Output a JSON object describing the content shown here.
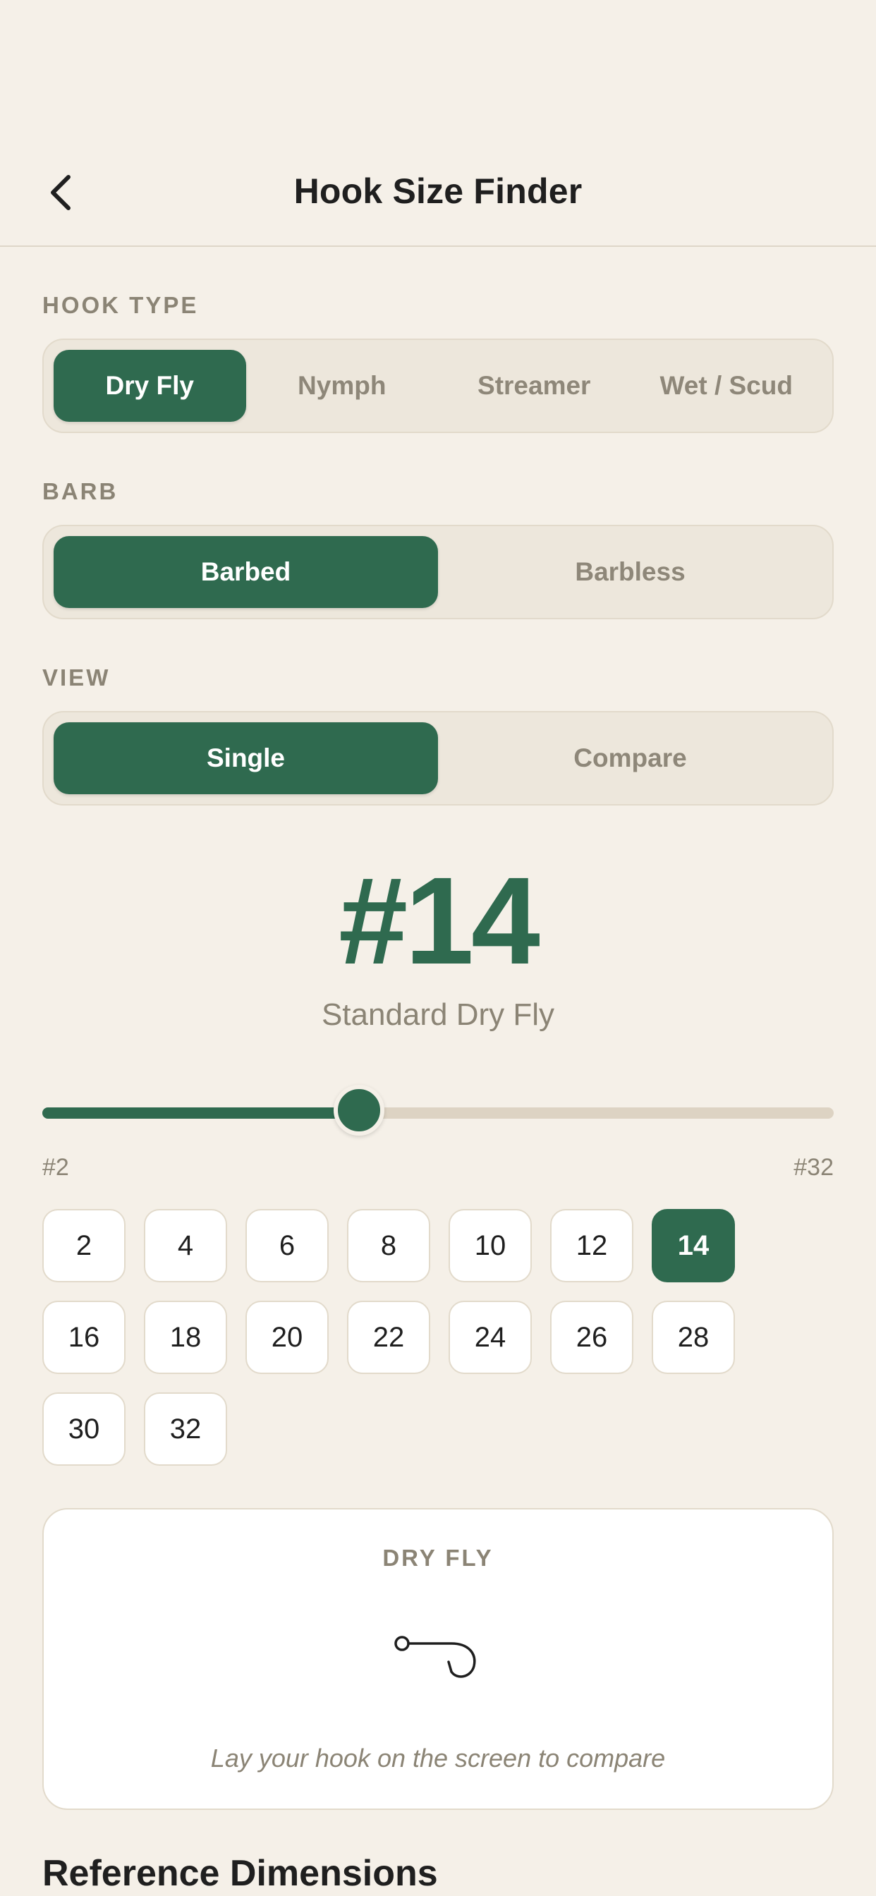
{
  "nav": {
    "title": "Hook Size Finder",
    "back_icon": "chevron-left-icon"
  },
  "hook_type": {
    "label": "HOOK TYPE",
    "options": [
      "Dry Fly",
      "Nymph",
      "Streamer",
      "Wet / Scud"
    ],
    "selected": "Dry Fly"
  },
  "barb": {
    "label": "BARB",
    "options": [
      "Barbed",
      "Barbless"
    ],
    "selected": "Barbed"
  },
  "view": {
    "label": "VIEW",
    "options": [
      "Single",
      "Compare"
    ],
    "selected": "Single"
  },
  "selected_size": {
    "display": "#14",
    "description": "Standard Dry Fly"
  },
  "slider": {
    "min_label": "#2",
    "max_label": "#32",
    "min": 2,
    "max": 32,
    "value": 14
  },
  "sizes": [
    "2",
    "4",
    "6",
    "8",
    "10",
    "12",
    "14",
    "16",
    "18",
    "20",
    "22",
    "24",
    "26",
    "28",
    "30",
    "32"
  ],
  "active_size": "14",
  "preview": {
    "label": "DRY FLY",
    "icon": "hook-icon",
    "hint": "Lay your hook on the screen to compare"
  },
  "reference": {
    "heading": "Reference Dimensions"
  },
  "colors": {
    "accent": "#2f6a4f",
    "background": "#f5f0e8",
    "muted_text": "#8b8475"
  }
}
